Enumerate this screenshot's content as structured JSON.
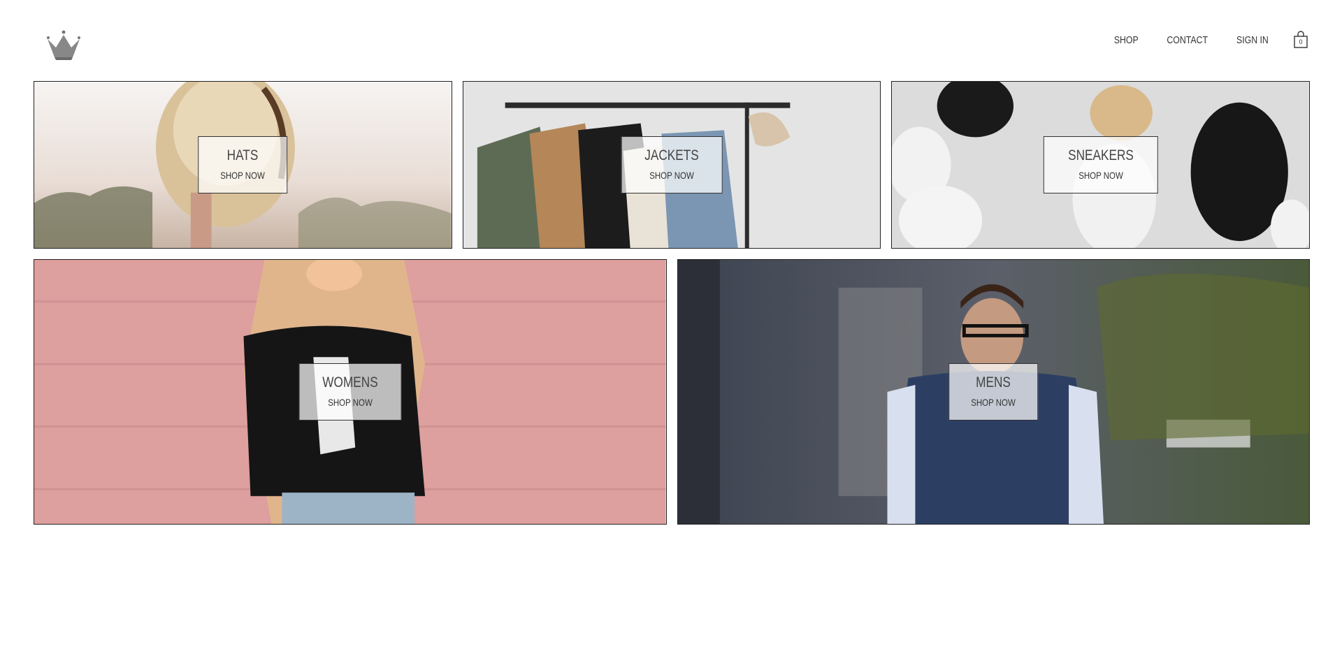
{
  "header": {
    "logo_icon": "crown-icon",
    "nav": [
      {
        "label": "SHOP"
      },
      {
        "label": "CONTACT"
      },
      {
        "label": "SIGN IN"
      }
    ],
    "cart": {
      "icon": "shopping-bag-icon",
      "count": "0"
    }
  },
  "categories": [
    {
      "title": "HATS",
      "cta": "SHOP NOW"
    },
    {
      "title": "JACKETS",
      "cta": "SHOP NOW"
    },
    {
      "title": "SNEAKERS",
      "cta": "SHOP NOW"
    },
    {
      "title": "WOMENS",
      "cta": "SHOP NOW"
    },
    {
      "title": "MENS",
      "cta": "SHOP NOW"
    }
  ],
  "colors": {
    "text": "#333333",
    "border": "#222222",
    "label_bg": "#ffffff"
  }
}
